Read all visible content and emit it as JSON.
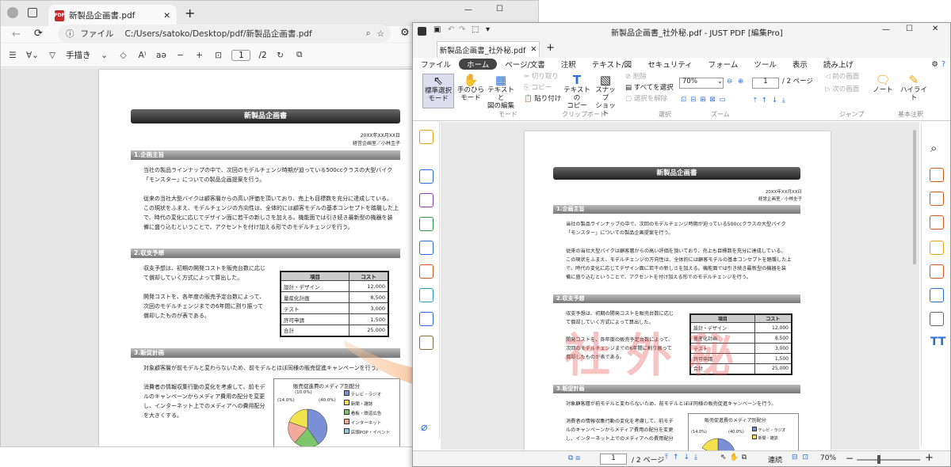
{
  "browser": {
    "tab_title": "新製品企画書.pdf",
    "url_prefix": "ファイル",
    "url": "C:/Users/satoko/Desktop/pdf/新製品企画書.pdf",
    "draw_label": "手描き",
    "page_current": "1",
    "page_total": "/2"
  },
  "jp": {
    "window_title": "新製品企画書_社外秘.pdf - JUST PDF [編集Pro]",
    "file_tab": "新製品企画書_社外秘.pdf",
    "menu": [
      "ファイル",
      "ホーム",
      "ページ/文書",
      "注釈",
      "テキスト/図",
      "セキュリティ",
      "フォーム",
      "ツール",
      "表示",
      "読み上げ"
    ],
    "ribbon": {
      "std_select": "標準選択\nモード",
      "hand": "手のひら\nモード",
      "text_fig": "テキストと\n図の編集",
      "cut": "切り取り",
      "copy": "コピー",
      "paste": "貼り付け",
      "text_copy": "テキストの\nコピー",
      "snapshot": "スナップ\nショット",
      "delete": "削除",
      "select_all": "すべてを選択",
      "deselect": "選択を解除",
      "zoom": "70%",
      "page": "1",
      "page_total": "/ 2 ページ",
      "prev_page": "前の画面",
      "next_page": "次の画面",
      "note": "ノート",
      "highlight": "ハイライト",
      "grp_mode": "モード",
      "grp_clip": "クリップボード",
      "grp_select": "選択",
      "grp_zoom": "ズーム",
      "grp_jump": "ジャンプ",
      "grp_basic": "基本注釈"
    },
    "status": {
      "page": "1",
      "total": "/ 2 ページ",
      "layout": "連続",
      "zoom": "70%"
    },
    "watermark": "社外秘"
  },
  "doc": {
    "title": "新製品企画書",
    "date": "20XX年XX月XX日",
    "author": "経営企画室／小林圭子",
    "s1": "1.企画主旨",
    "s1p1a": "当社の製品ラインナップの中で、次回のモデルチェンジ時期が迫っている500ccクラスの大型バイク",
    "s1p1b": "「モンスター」についての製品企画提案を行う。",
    "s1p2a": "従来の当社大型バイクは顧客層からの高い評価を頂いており、売上も目標数を充分に達成している。",
    "s1p2b": "この現状をふまえ、モデルチェンジの方向性は、全体的には顧客モデルの基本コンセプトを踏襲した上",
    "s1p2c": "で、時代の変化に応じてデザイン面に若干の新しさを加える。機能面では引き続き最新型の機器を装",
    "s1p2d": "備に盛り込むということで、アクセントを付け加える形でのモデルチェンジを行う。",
    "s2": "2.収支予想",
    "s2p1a": "収支予想は、初期の開発コストを販売台数に応じ",
    "s2p1b": "て償却していく方式によって算出した。",
    "s2p2a": "開発コストを、各年度の販売予定台数によって、",
    "s2p2b": "次回のモデルチェンジまでの6年間に割り振って",
    "s2p2c": "償却したものが表である。",
    "table_head": [
      "項目",
      "コスト"
    ],
    "table_rows": [
      [
        "設計・デザイン",
        "12,000"
      ],
      [
        "量産化計画",
        "8,500"
      ],
      [
        "テスト",
        "3,000"
      ],
      [
        "許可申請",
        "1,500"
      ],
      [
        "合計",
        "25,000"
      ]
    ],
    "s3": "3.販促計画",
    "s3p1": "対象顧客層が前モデルと変わらないため、前モデルとほぼ同様の販売促進キャンペーンを行う。",
    "s3p2a": "消費者の情報収集行動の変化を考慮して、前モデ",
    "s3p2b": "ルのキャンペーンからメディア費用の配分を変更",
    "s3p2c": "し、インターネット上でのメディアへの費用配分",
    "s3p2d": "を大きくする。",
    "chart_title": "販売促進費のメディア別配分",
    "pie_labels": [
      "(10.0%)",
      "(14.0%)",
      "(40.0%)"
    ],
    "legend": [
      "テレビ・ラジオ",
      "新聞・雑誌",
      "看板・鉄道広告",
      "インターネット",
      "店頭POP・イベント"
    ]
  },
  "colors": {
    "legend": [
      "#7b8fd6",
      "#f2e24e",
      "#7dc76a",
      "#f4a99a",
      "#8ec9ea"
    ]
  }
}
